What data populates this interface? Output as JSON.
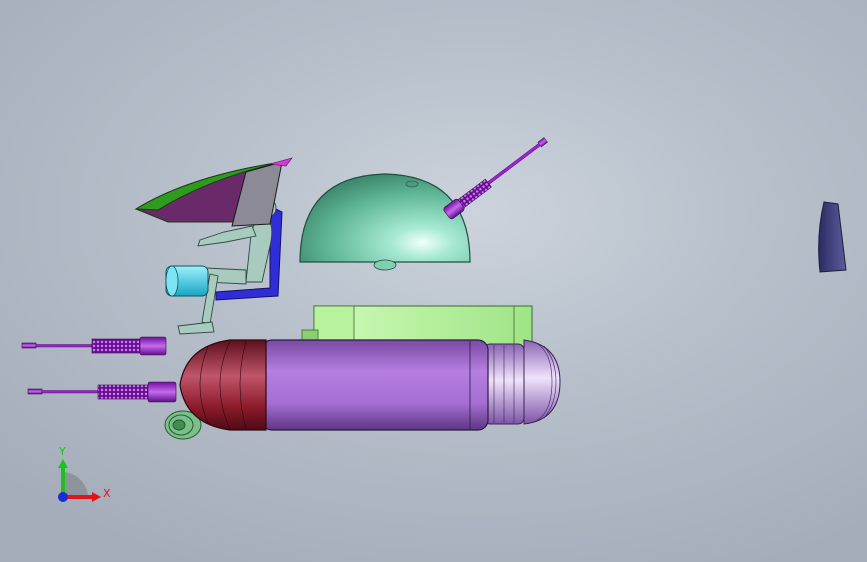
{
  "viewport": {
    "background_top": "#ccd3dc",
    "background_bottom": "#a4adb9"
  },
  "triad": {
    "x_label": "X",
    "y_label": "Y",
    "x_color": "#e3131b",
    "y_color": "#1bc21b",
    "z_color": "#1a2bd8"
  },
  "parts": {
    "fuselage_color": "#9b5fc4",
    "nose_color": "#8b1a2a",
    "engine_ring_color": "#c9a6e6",
    "deck_color": "#a6e88a",
    "dome_color": "#6fc7a8",
    "gun_color": "#9c1fd3",
    "seat_color": "#2f2ed6",
    "canopy_color": "#2e9a1e",
    "pilot_color": "#a9cbbf",
    "boot_color": "#35d0e6",
    "wheel_color": "#3f8f4f",
    "fin_color": "#3f3f7a"
  }
}
